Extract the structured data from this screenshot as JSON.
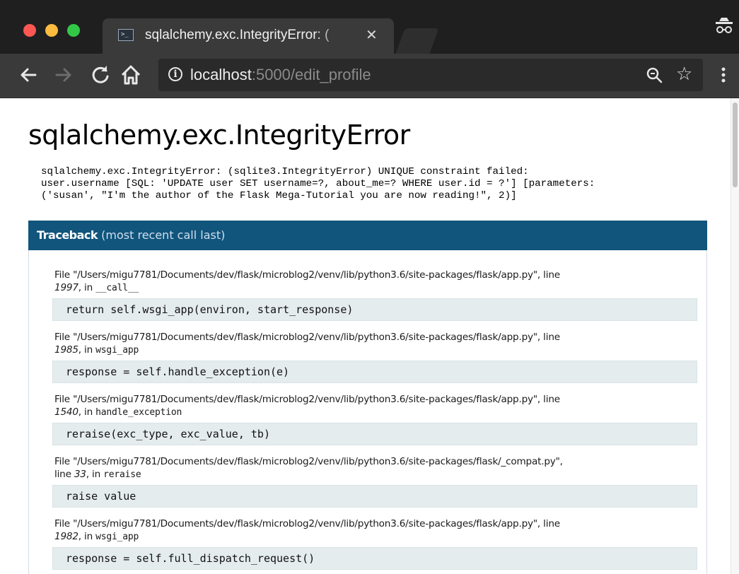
{
  "browser": {
    "tab_title": "sqlalchemy.exc.IntegrityError: (",
    "tab_close": "✕",
    "url_host": "localhost",
    "url_rest": ":5000/edit_profile",
    "info_icon_glyph": "i",
    "icons": {
      "back": "back-arrow-icon",
      "forward": "forward-arrow-icon",
      "reload": "reload-icon",
      "home": "home-icon",
      "zoom": "zoom-magnifier-icon",
      "bookmark": "star-icon",
      "menu": "kebab-menu-icon",
      "incognito": "incognito-icon"
    }
  },
  "error": {
    "title": "sqlalchemy.exc.IntegrityError",
    "message": "sqlalchemy.exc.IntegrityError: (sqlite3.IntegrityError) UNIQUE constraint failed:\nuser.username [SQL: 'UPDATE user SET username=?, about_me=? WHERE user.id = ?'] [parameters:\n('susan', \"I'm the author of the Flask Mega-Tutorial you are now reading!\", 2)]"
  },
  "traceback": {
    "header_strong": "Traceback",
    "header_light": "(most recent call last)",
    "frames": [
      {
        "file_prefix": "File \"/Users/migu7781/Documents/dev/flask/microblog2/venv/lib/python3.6/site-packages/flask/app.py\", line",
        "line": "1997",
        "in_text": ", in ",
        "function": "__call__",
        "code": "return self.wsgi_app(environ, start_response)"
      },
      {
        "file_prefix": "File \"/Users/migu7781/Documents/dev/flask/microblog2/venv/lib/python3.6/site-packages/flask/app.py\", line",
        "line": "1985",
        "in_text": ", in ",
        "function": "wsgi_app",
        "code": "response = self.handle_exception(e)"
      },
      {
        "file_prefix": "File \"/Users/migu7781/Documents/dev/flask/microblog2/venv/lib/python3.6/site-packages/flask/app.py\", line",
        "line": "1540",
        "in_text": ", in ",
        "function": "handle_exception",
        "code": "reraise(exc_type, exc_value, tb)"
      },
      {
        "file_prefix": "File \"/Users/migu7781/Documents/dev/flask/microblog2/venv/lib/python3.6/site-packages/flask/_compat.py\",",
        "line_prefix": "line ",
        "line": "33",
        "in_text": ", in ",
        "function": "reraise",
        "code": "raise value"
      },
      {
        "file_prefix": "File \"/Users/migu7781/Documents/dev/flask/microblog2/venv/lib/python3.6/site-packages/flask/app.py\", line",
        "line": "1982",
        "in_text": ", in ",
        "function": "wsgi_app",
        "code": "response = self.full_dispatch_request()"
      }
    ]
  },
  "colors": {
    "traceback_header_bg": "#11557c",
    "code_bg": "#e5ecee",
    "chrome_dark": "#1f1f20",
    "chrome_toolbar": "#3a3a3b"
  }
}
